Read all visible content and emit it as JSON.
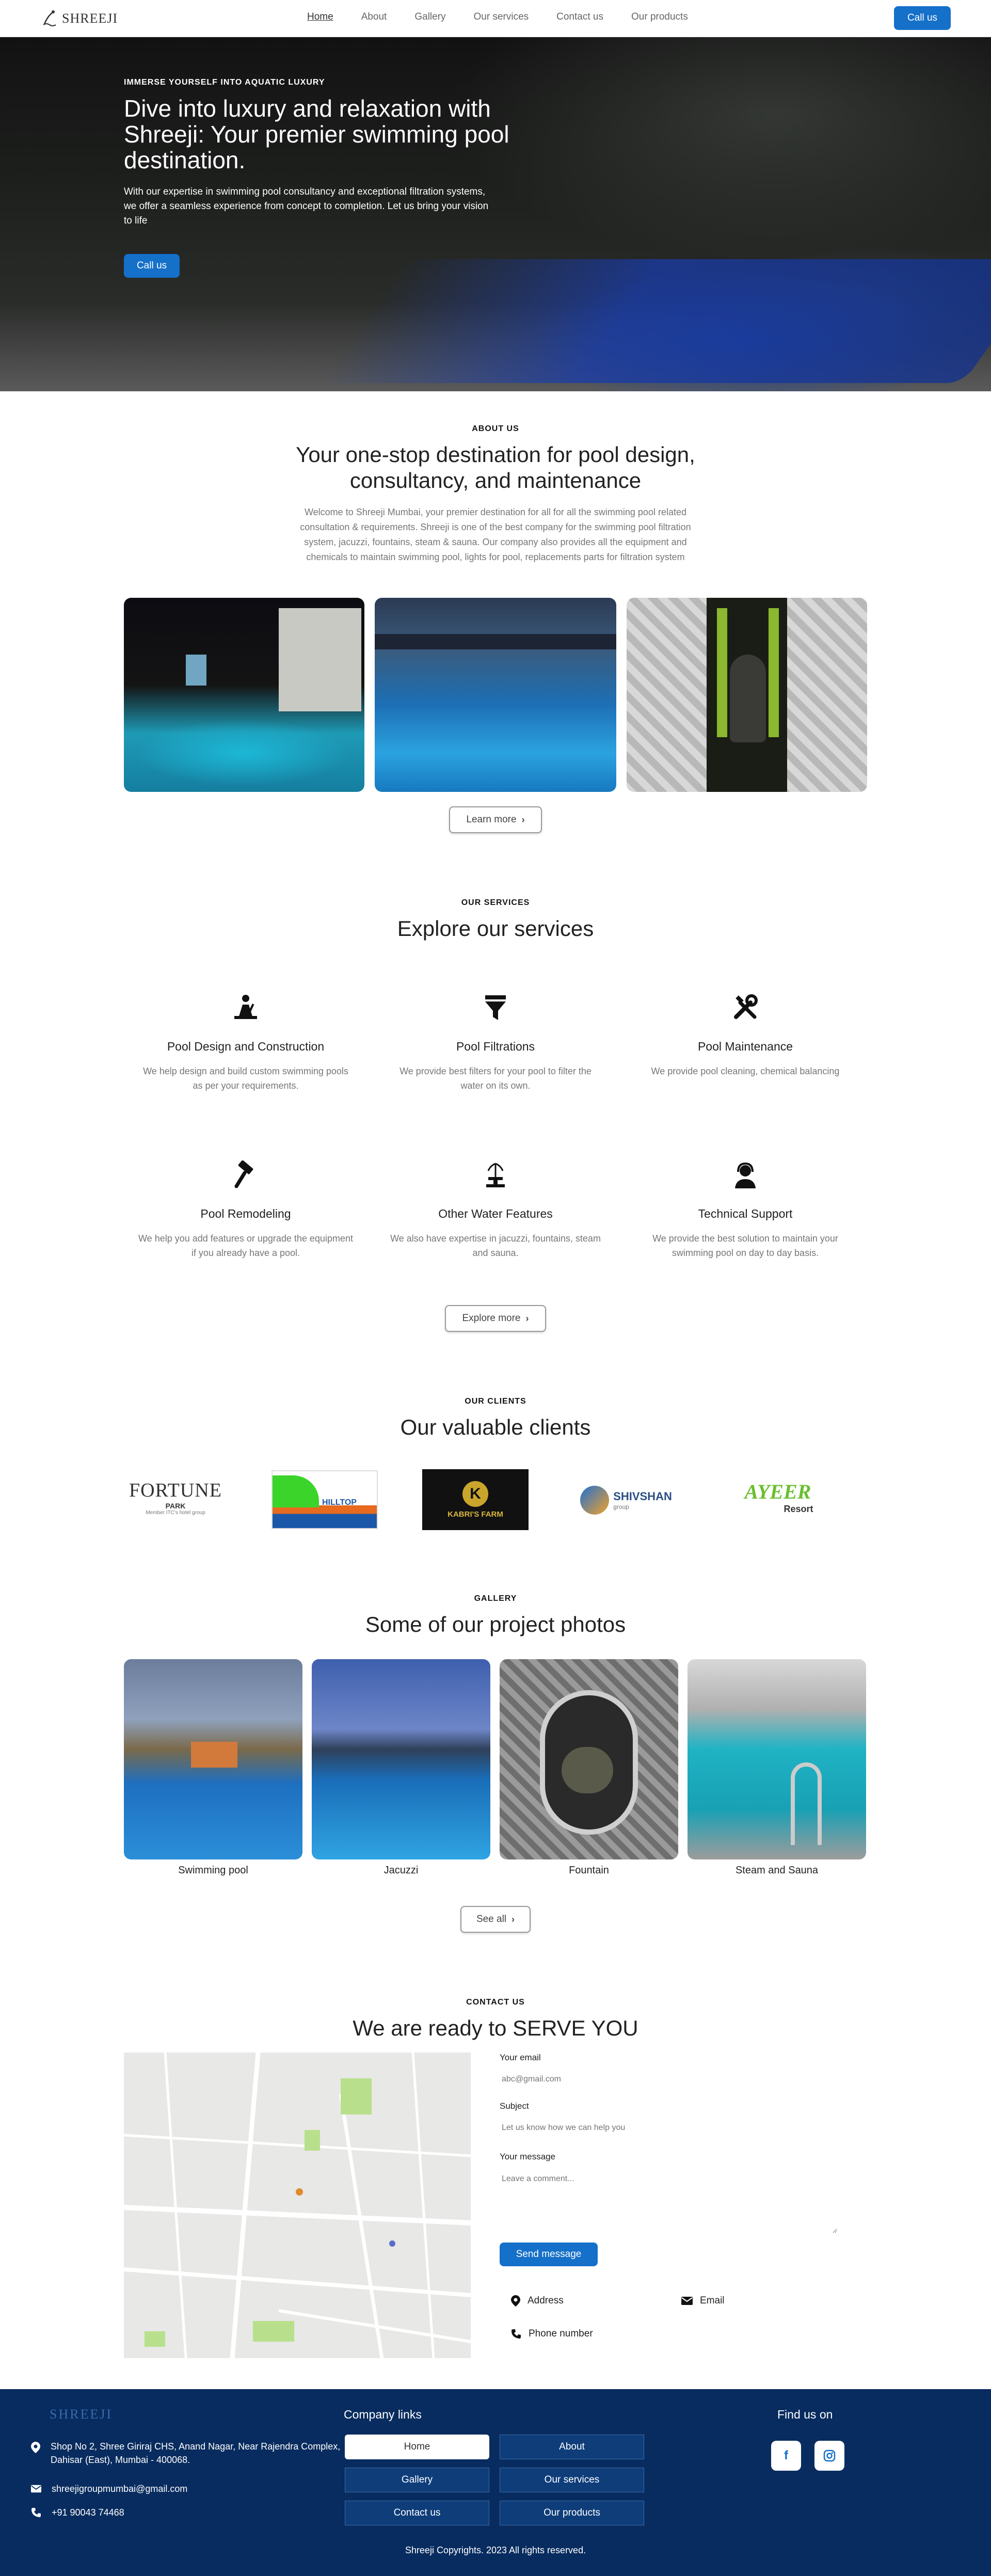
{
  "nav": {
    "brand": "SHREEJI",
    "links": [
      "Home",
      "About",
      "Gallery",
      "Our services",
      "Contact us",
      "Our products"
    ],
    "call_label": "Call us"
  },
  "hero": {
    "eyebrow": "IMMERSE YOURSELF INTO AQUATIC LUXURY",
    "title": "Dive into luxury and relaxation with Shreeji: Your premier swimming pool destination.",
    "text": "With our expertise in swimming pool consultancy and exceptional filtration systems, we offer a seamless experience from concept to completion. Let us bring your vision to life",
    "call_label": "Call us"
  },
  "about": {
    "eyebrow": "ABOUT US",
    "title": "Your one-stop destination for pool design, consultancy, and maintenance",
    "text": "Welcome to Shreeji Mumbai, your premier destination for all for all the swimming pool related consultation & requirements. Shreeji is one of the best company for the swimming pool filtration system, jacuzzi, fountains, steam & sauna. Our company also provides all the equipment and chemicals to maintain swimming pool, lights for pool, replacements parts for filtration system",
    "learn_more": "Learn more"
  },
  "services": {
    "eyebrow": "OUR SERVICES",
    "title": "Explore our services",
    "items": [
      {
        "icon": "construction-worker-icon",
        "title": "Pool Design and Construction",
        "desc": "We help design and build custom swimming pools as per your requirements."
      },
      {
        "icon": "filter-icon",
        "title": "Pool Filtrations",
        "desc": "We provide best filters for your pool to filter the water on its own."
      },
      {
        "icon": "tools-icon",
        "title": "Pool Maintenance",
        "desc": "We provide pool cleaning, chemical balancing"
      },
      {
        "icon": "hammer-icon",
        "title": "Pool Remodeling",
        "desc": "We help you add features or upgrade the equipment if you already have a pool."
      },
      {
        "icon": "fountain-icon",
        "title": "Other Water Features",
        "desc": "We also have expertise in jacuzzi, fountains, steam and sauna."
      },
      {
        "icon": "headset-icon",
        "title": "Technical Support",
        "desc": "We provide the best solution to maintain your swimming pool on day to day basis."
      }
    ],
    "explore_more": "Explore more"
  },
  "clients": {
    "eyebrow": "OUR CLIENTS",
    "title": "Our valuable clients",
    "logos": [
      {
        "name": "fortune-park-logo",
        "line1": "FORTUNE",
        "line2": "PARK",
        "line3": "Member ITC's hotel group"
      },
      {
        "name": "hilltop-logo",
        "line1": "HILLTOP",
        "line2": "",
        "line3": ""
      },
      {
        "name": "kabris-farm-logo",
        "line1": "K",
        "line2": "KABRI'S FARM",
        "line3": ""
      },
      {
        "name": "shivshan-logo",
        "line1": "SHIVSHAN",
        "line2": "group",
        "line3": ""
      },
      {
        "name": "ayeer-resort-logo",
        "line1": "AYEER",
        "line2": "Resort",
        "line3": ""
      }
    ]
  },
  "gallery": {
    "eyebrow": "GALLERY",
    "title": "Some of our project photos",
    "items": [
      "Swimming pool",
      "Jacuzzi",
      "Fountain",
      "Steam and Sauna"
    ],
    "see_all": "See all"
  },
  "contact": {
    "eyebrow": "CONTACT US",
    "title": "We are ready to SERVE YOU",
    "email_label": "Your email",
    "email_placeholder": "abc@gmail.com",
    "subject_label": "Subject",
    "subject_placeholder": "Let us know how we can help you",
    "message_label": "Your message",
    "message_placeholder": "Leave a comment...",
    "send_label": "Send message",
    "address_label": "Address",
    "email_link_label": "Email",
    "phone_label": "Phone number"
  },
  "footer": {
    "brand": "SHREEJI",
    "address": "Shop No 2, Shree Giriraj CHS, Anand Nagar, Near Rajendra Complex, Dahisar (East), Mumbai - 400068.",
    "email": "shreejigroupmumbai@gmail.com",
    "phone": "+91 90043 74468",
    "company_links_heading": "Company links",
    "links": [
      "Home",
      "About",
      "Gallery",
      "Our services",
      "Contact us",
      "Our products"
    ],
    "find_us_heading": "Find us on",
    "copyright": "Shreeji Copyrights. 2023 All rights reserved."
  },
  "colors": {
    "primary": "#1570c9",
    "footer_bg": "#082c5f"
  }
}
